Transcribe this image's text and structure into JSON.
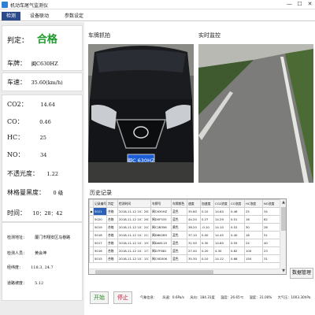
{
  "window": {
    "title": "机动车尾气监测仪",
    "minimize": "—",
    "maximize": "☐",
    "close": "✕"
  },
  "tabs": [
    "检测",
    "设备联动",
    "参数设定"
  ],
  "left_panel": {
    "verdict": {
      "label": "判定：",
      "value": "合格"
    },
    "plate": {
      "label": "车牌：",
      "value": "闽C630HZ"
    },
    "speed": {
      "label": "车速：",
      "value": "35.60(km/h)"
    },
    "gases": [
      {
        "label": "CO2：",
        "value": "14.64"
      },
      {
        "label": "CO：",
        "value": "0.46"
      },
      {
        "label": "HC：",
        "value": "25"
      },
      {
        "label": "NO：",
        "value": "34"
      }
    ],
    "opacity": {
      "label": "不透光度：",
      "value": "1.22"
    },
    "ringelmann": {
      "label": "林格曼黑度：",
      "value": "0 级"
    },
    "time": {
      "label": "时间：",
      "value": "10：28：42"
    },
    "site": {
      "address_label": "检测地址：",
      "address_value": "厦门市翔安区马巷路",
      "operator_label": "检测人员：",
      "operator_value": "黄会坤",
      "lonlat_label": "经纬度：",
      "lonlat_value": "118.3, 24.7",
      "slope_label": "道路坡度：",
      "slope_value": "5.12"
    },
    "start_label": "开始",
    "stop_label": "停止"
  },
  "sections": {
    "plate_capture": "车牌抓拍",
    "live_view": "实时监控",
    "history": "历史记录"
  },
  "plate_photo": {
    "plate_text": "闽C 630HZ"
  },
  "history": {
    "columns": [
      "记录编号",
      "判定",
      "检测时间",
      "车牌号",
      "车牌颜色",
      "速度",
      "加速度",
      "CO2浓度",
      "CO浓度",
      "HC浓度",
      "NO浓度"
    ],
    "rows": [
      [
        "5021",
        "合格",
        "2018-11-12 10：28：42",
        "闽C630HZ",
        "蓝色",
        "35.60",
        "0.10",
        "14.64",
        "0.46",
        "25",
        "34"
      ],
      [
        "5020",
        "合格",
        "2018-11-12 10：26：17",
        "闽D5F533",
        "蓝色",
        "44.20",
        "0.27",
        "14.29",
        "0.51",
        "16",
        "62"
      ],
      [
        "5019",
        "合格",
        "2018-11-12 10：24：03",
        "闽C2B356",
        "黄色",
        "38.20",
        "-0.10",
        "14.10",
        "0.52",
        "30",
        "28"
      ],
      [
        "5018",
        "合格",
        "2018-11-12 10：21：55",
        "闽D6K289",
        "蓝色",
        "37.10",
        "0.00",
        "14.45",
        "0.40",
        "18",
        "51"
      ],
      [
        "5017",
        "合格",
        "2018-11-12 10：19：48",
        "闽DA8119",
        "蓝色",
        "31.50",
        "0.30",
        "14.60",
        "0.55",
        "24",
        "40"
      ],
      [
        "5016",
        "合格",
        "2018-11-12 10：17：30",
        "闽D7F881",
        "蓝色",
        "27.40",
        "0.20",
        "4.30",
        "0.82",
        "100",
        "23"
      ],
      [
        "5015",
        "合格",
        "2018-11-12 10：15：12",
        "闽C9D306",
        "蓝色",
        "35.30",
        "0.10",
        "14.12",
        "0.68",
        "150",
        "31"
      ]
    ]
  },
  "data_manage_label": "数据管理",
  "status_bar": [
    "气象信息：",
    "风速：0.6Pa/s",
    "风向：184.31度",
    "温度：26.65℃",
    "湿度：31.00%",
    "大气压：1003.30hPa"
  ],
  "colors": {
    "accent_tab": "#2a4a8a",
    "verdict": "#1a9a2a",
    "plate_blue": "#1c5ed6",
    "stop_button": "#c8102e",
    "start_button": "#2a8a2a"
  }
}
